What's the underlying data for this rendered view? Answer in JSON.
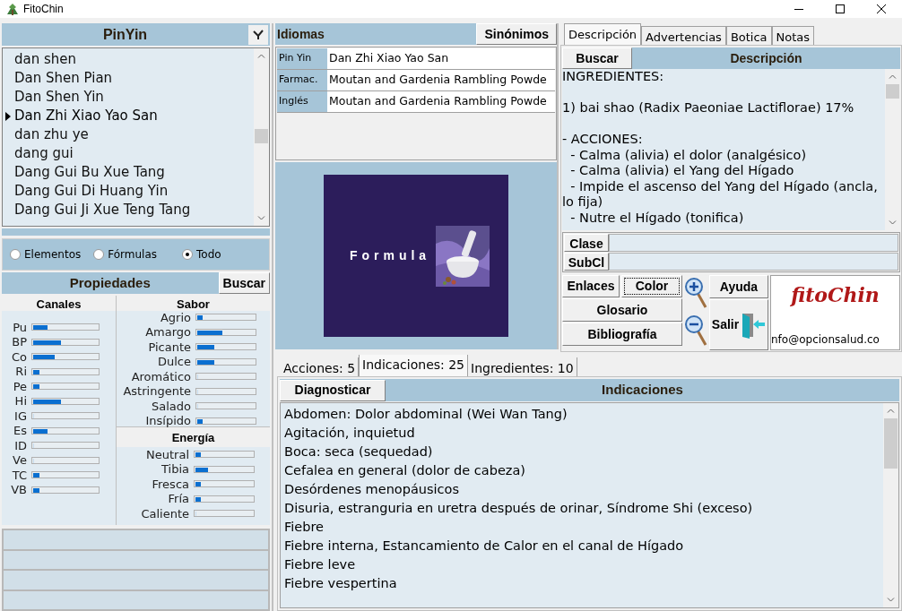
{
  "window": {
    "title": "FitoChin"
  },
  "pinyin": {
    "title": "PinYin",
    "items": [
      {
        "label": "dan shen",
        "selected": false
      },
      {
        "label": "Dan Shen Pian",
        "selected": false
      },
      {
        "label": "Dan Shen Yin",
        "selected": false
      },
      {
        "label": "Dan Zhi Xiao Yao San",
        "selected": true
      },
      {
        "label": "dan zhu ye",
        "selected": false
      },
      {
        "label": "dang gui",
        "selected": false
      },
      {
        "label": "Dang Gui Bu Xue Tang",
        "selected": false
      },
      {
        "label": "Dang Gui Di Huang Yin",
        "selected": false
      },
      {
        "label": "Dang Gui Ji Xue Teng Tang",
        "selected": false
      }
    ]
  },
  "filter": [
    {
      "label": "Elementos",
      "selected": false
    },
    {
      "label": "Fórmulas",
      "selected": false
    },
    {
      "label": "Todo",
      "selected": true
    }
  ],
  "properties": {
    "title": "Propiedades",
    "search_button": "Buscar",
    "canales": {
      "title": "Canales",
      "items": [
        {
          "label": "Pu",
          "level": 0.22
        },
        {
          "label": "BP",
          "level": 0.43
        },
        {
          "label": "Co",
          "level": 0.33
        },
        {
          "label": "Ri",
          "level": 0.1
        },
        {
          "label": "Pe",
          "level": 0.1
        },
        {
          "label": "Hi",
          "level": 0.43
        },
        {
          "label": "IG",
          "level": 0
        },
        {
          "label": "Es",
          "level": 0.22
        },
        {
          "label": "ID",
          "level": 0
        },
        {
          "label": "Ve",
          "level": 0
        },
        {
          "label": "TC",
          "level": 0.1
        },
        {
          "label": "VB",
          "level": 0.1
        }
      ]
    },
    "sabor": {
      "title": "Sabor",
      "items": [
        {
          "label": "Agrio",
          "level": 0.1
        },
        {
          "label": "Amargo",
          "level": 0.43
        },
        {
          "label": "Picante",
          "level": 0.3
        },
        {
          "label": "Dulce",
          "level": 0.3
        },
        {
          "label": "Aromático",
          "level": 0
        },
        {
          "label": "Astringente",
          "level": 0
        },
        {
          "label": "Salado",
          "level": 0
        },
        {
          "label": "Insípido",
          "level": 0.1
        }
      ]
    },
    "energia": {
      "title": "Energía",
      "items": [
        {
          "label": "Neutral",
          "level": 0.1
        },
        {
          "label": "Tibia",
          "level": 0.22
        },
        {
          "label": "Fresca",
          "level": 0.1
        },
        {
          "label": "Fría",
          "level": 0.1
        },
        {
          "label": "Caliente",
          "level": 0
        }
      ]
    }
  },
  "idiomas": {
    "title": "Idiomas",
    "button": "Sinónimos",
    "rows": [
      {
        "label": "Pin Yin",
        "value": "Dan Zhi Xiao Yao San"
      },
      {
        "label": "Farmac.",
        "value": "Moutan and Gardenia Rambling Powde"
      },
      {
        "label": "Inglés",
        "value": "Moutan and Gardenia Rambling Powde"
      }
    ]
  },
  "image": {
    "kind": "picture",
    "caption": "Formula"
  },
  "detail_tabs": [
    {
      "label": "Descripción",
      "selected": true
    },
    {
      "label": "Advertencias",
      "selected": false
    },
    {
      "label": "Botica",
      "selected": false
    },
    {
      "label": "Notas",
      "selected": false
    }
  ],
  "description": {
    "search_button": "Buscar",
    "title": "Descripción",
    "paragraphs": [
      [
        "INGREDIENTES:"
      ],
      [
        "1) bai shao (Radix Paeoniae Lactiflorae) 17%"
      ],
      [
        "- ACCIONES:",
        "  - Calma (alivia) el dolor (analgésico)",
        "  - Calma (alivia) el Yang del Hígado",
        "  - Impide el ascenso del Yang del Hígado (ancla, lo fija)",
        "  - Nutre el Hígado (tonifica)"
      ]
    ]
  },
  "classification": [
    {
      "label": "Clase"
    },
    {
      "label": "SubCl"
    }
  ],
  "actions": {
    "enlaces": "Enlaces",
    "color_button": "Color",
    "glosario": "Glosario",
    "bibliografia": "Bibliografía",
    "ayuda": "Ayuda",
    "salir": "Salir"
  },
  "logo": {
    "name": "fitoChin",
    "email": "nfo@opcionsalud.co"
  },
  "bottom_tabs": [
    {
      "label": "Acciones: 5",
      "selected": false
    },
    {
      "label": "Indicaciones: 25",
      "selected": true
    },
    {
      "label": "Ingredientes: 10",
      "selected": false
    }
  ],
  "indications": {
    "button": "Diagnosticar",
    "title": "Indicaciones",
    "items": [
      "Abdomen: Dolor abdominal (Wei Wan Tang)",
      "Agitación, inquietud",
      "Boca: seca (sequedad)",
      "Cefalea en general (dolor de cabeza)",
      "Desórdenes menopáusicos",
      "Disuria, estranguria en uretra después de orinar, Síndrome Shi (exceso)",
      "Fiebre",
      "Fiebre interna, Estancamiento de Calor en el canal de Hígado",
      "Fiebre leve",
      "Fiebre vespertina"
    ]
  }
}
